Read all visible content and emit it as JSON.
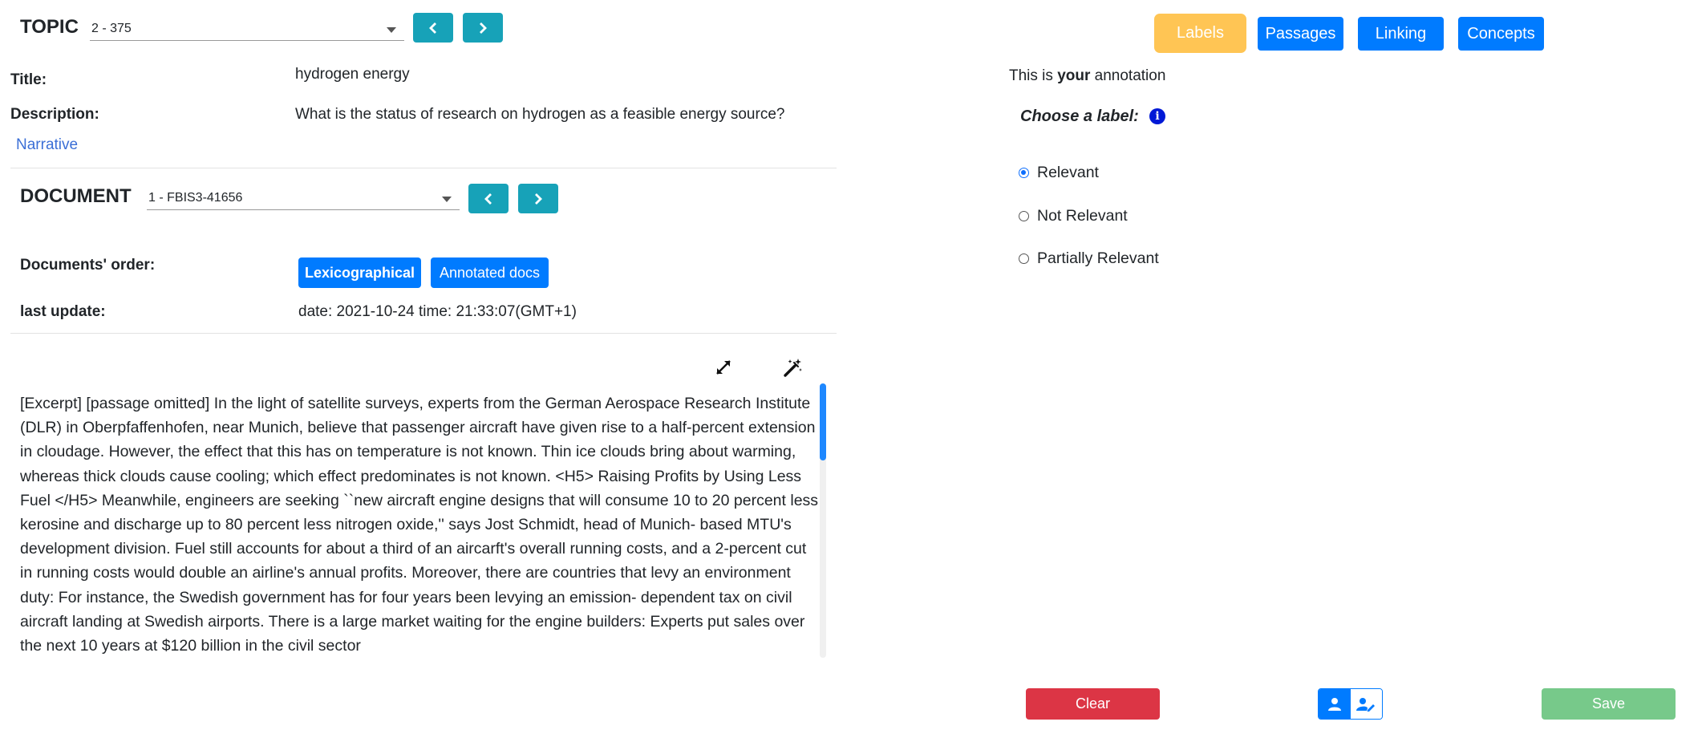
{
  "topic": {
    "label": "TOPIC",
    "selected": "2 - 375",
    "title_label": "Title:",
    "title_value": "hydrogen energy",
    "description_label": "Description:",
    "description_value": "What is the status of research on hydrogen as a feasible energy source?",
    "narrative_link": "Narrative"
  },
  "document": {
    "label": "DOCUMENT",
    "selected": "1 - FBIS3-41656",
    "order_label": "Documents' order:",
    "order_buttons": [
      "Lexicographical",
      "Annotated docs"
    ],
    "last_update_label": "last update:",
    "last_update_value": "date: 2021-10-24 time: 21:33:07(GMT+1)",
    "text": "[Excerpt] [passage omitted] In the light of satellite surveys, experts from the German Aerospace Research Institute (DLR) in Oberpfaffenhofen, near Munich, believe that passenger aircraft have given rise to a half-percent extension in cloudage. However, the effect that this has on temperature is not known. Thin ice clouds bring about warming, whereas thick clouds cause cooling; which effect predominates is not known. <H5> Raising Profits by Using Less Fuel </H5> Meanwhile, engineers are seeking ``new aircraft engine designs that will consume 10 to 20 percent less kerosine and discharge up to 80 percent less nitrogen oxide,'' says Jost Schmidt, head of Munich- based MTU's development division. Fuel still accounts for about a third of an aircarft's overall running costs, and a 2-percent cut in running costs would double an airline's annual profits. Moreover, there are countries that levy an environment duty: For instance, the Swedish government has for four years been levying an emission- dependent tax on civil aircraft landing at Swedish airports. There is a large market waiting for the engine builders: Experts put sales over the next 10 years at $120 billion in the civil sector"
  },
  "tabs": [
    "Labels",
    "Passages",
    "Linking",
    "Concepts"
  ],
  "annotation": {
    "intro_prefix": "This is ",
    "intro_bold": "your",
    "intro_suffix": " annotation",
    "choose_label": "Choose a label:",
    "options": [
      "Relevant",
      "Not Relevant",
      "Partially Relevant"
    ],
    "selected": "Relevant"
  },
  "actions": {
    "clear": "Clear",
    "save": "Save"
  },
  "colors": {
    "teal": "#17a2b8",
    "primary": "#007bff",
    "warning": "#ffc554",
    "danger": "#dc3545",
    "success": "#77c98a"
  }
}
